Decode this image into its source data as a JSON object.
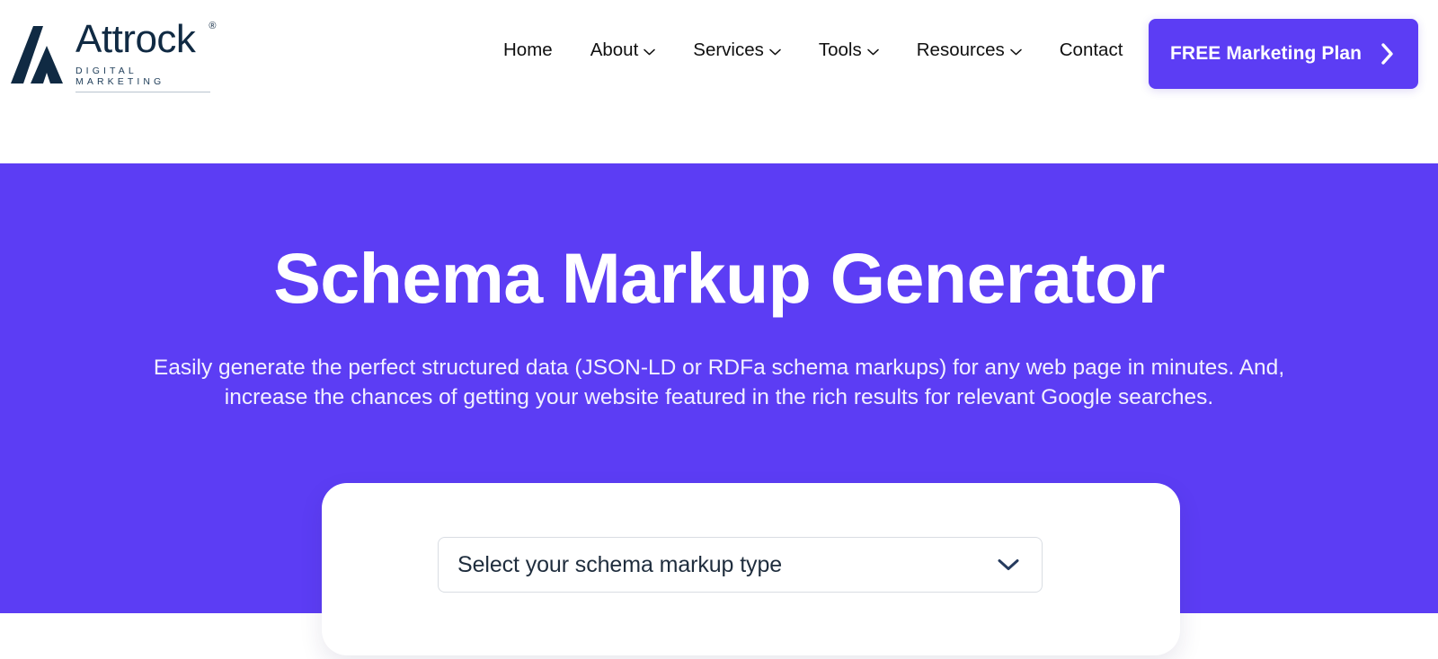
{
  "brand": {
    "name": "Attrock",
    "tagline": "DIGITAL MARKETING",
    "registered_mark": "®",
    "logo_icon": "attrock-a-mark-icon",
    "color": "#102a43"
  },
  "header": {
    "nav": [
      {
        "label": "Home",
        "has_dropdown": false,
        "icon": ""
      },
      {
        "label": "About",
        "has_dropdown": true,
        "icon": "chevron-down-icon"
      },
      {
        "label": "Services",
        "has_dropdown": true,
        "icon": "chevron-down-icon"
      },
      {
        "label": "Tools",
        "has_dropdown": true,
        "icon": "chevron-down-icon"
      },
      {
        "label": "Resources",
        "has_dropdown": true,
        "icon": "chevron-down-icon"
      },
      {
        "label": "Contact",
        "has_dropdown": false,
        "icon": ""
      }
    ],
    "cta": {
      "label": "FREE Marketing Plan",
      "icon": "chevron-right-icon",
      "background": "#5c3df4",
      "text_color": "#ffffff"
    }
  },
  "hero": {
    "title": "Schema Markup Generator",
    "subtitle": "Easily generate the perfect structured data (JSON-LD or RDFa schema markups) for any web page in minutes. And, increase the chances of getting your website featured in the rich results for relevant Google searches.",
    "background": "#5c3df4",
    "text_color": "#ffffff"
  },
  "tool_card": {
    "schema_select": {
      "value": "Select your schema markup type",
      "placeholder": "Select your schema markup type",
      "icon": "chevron-down-icon"
    }
  }
}
